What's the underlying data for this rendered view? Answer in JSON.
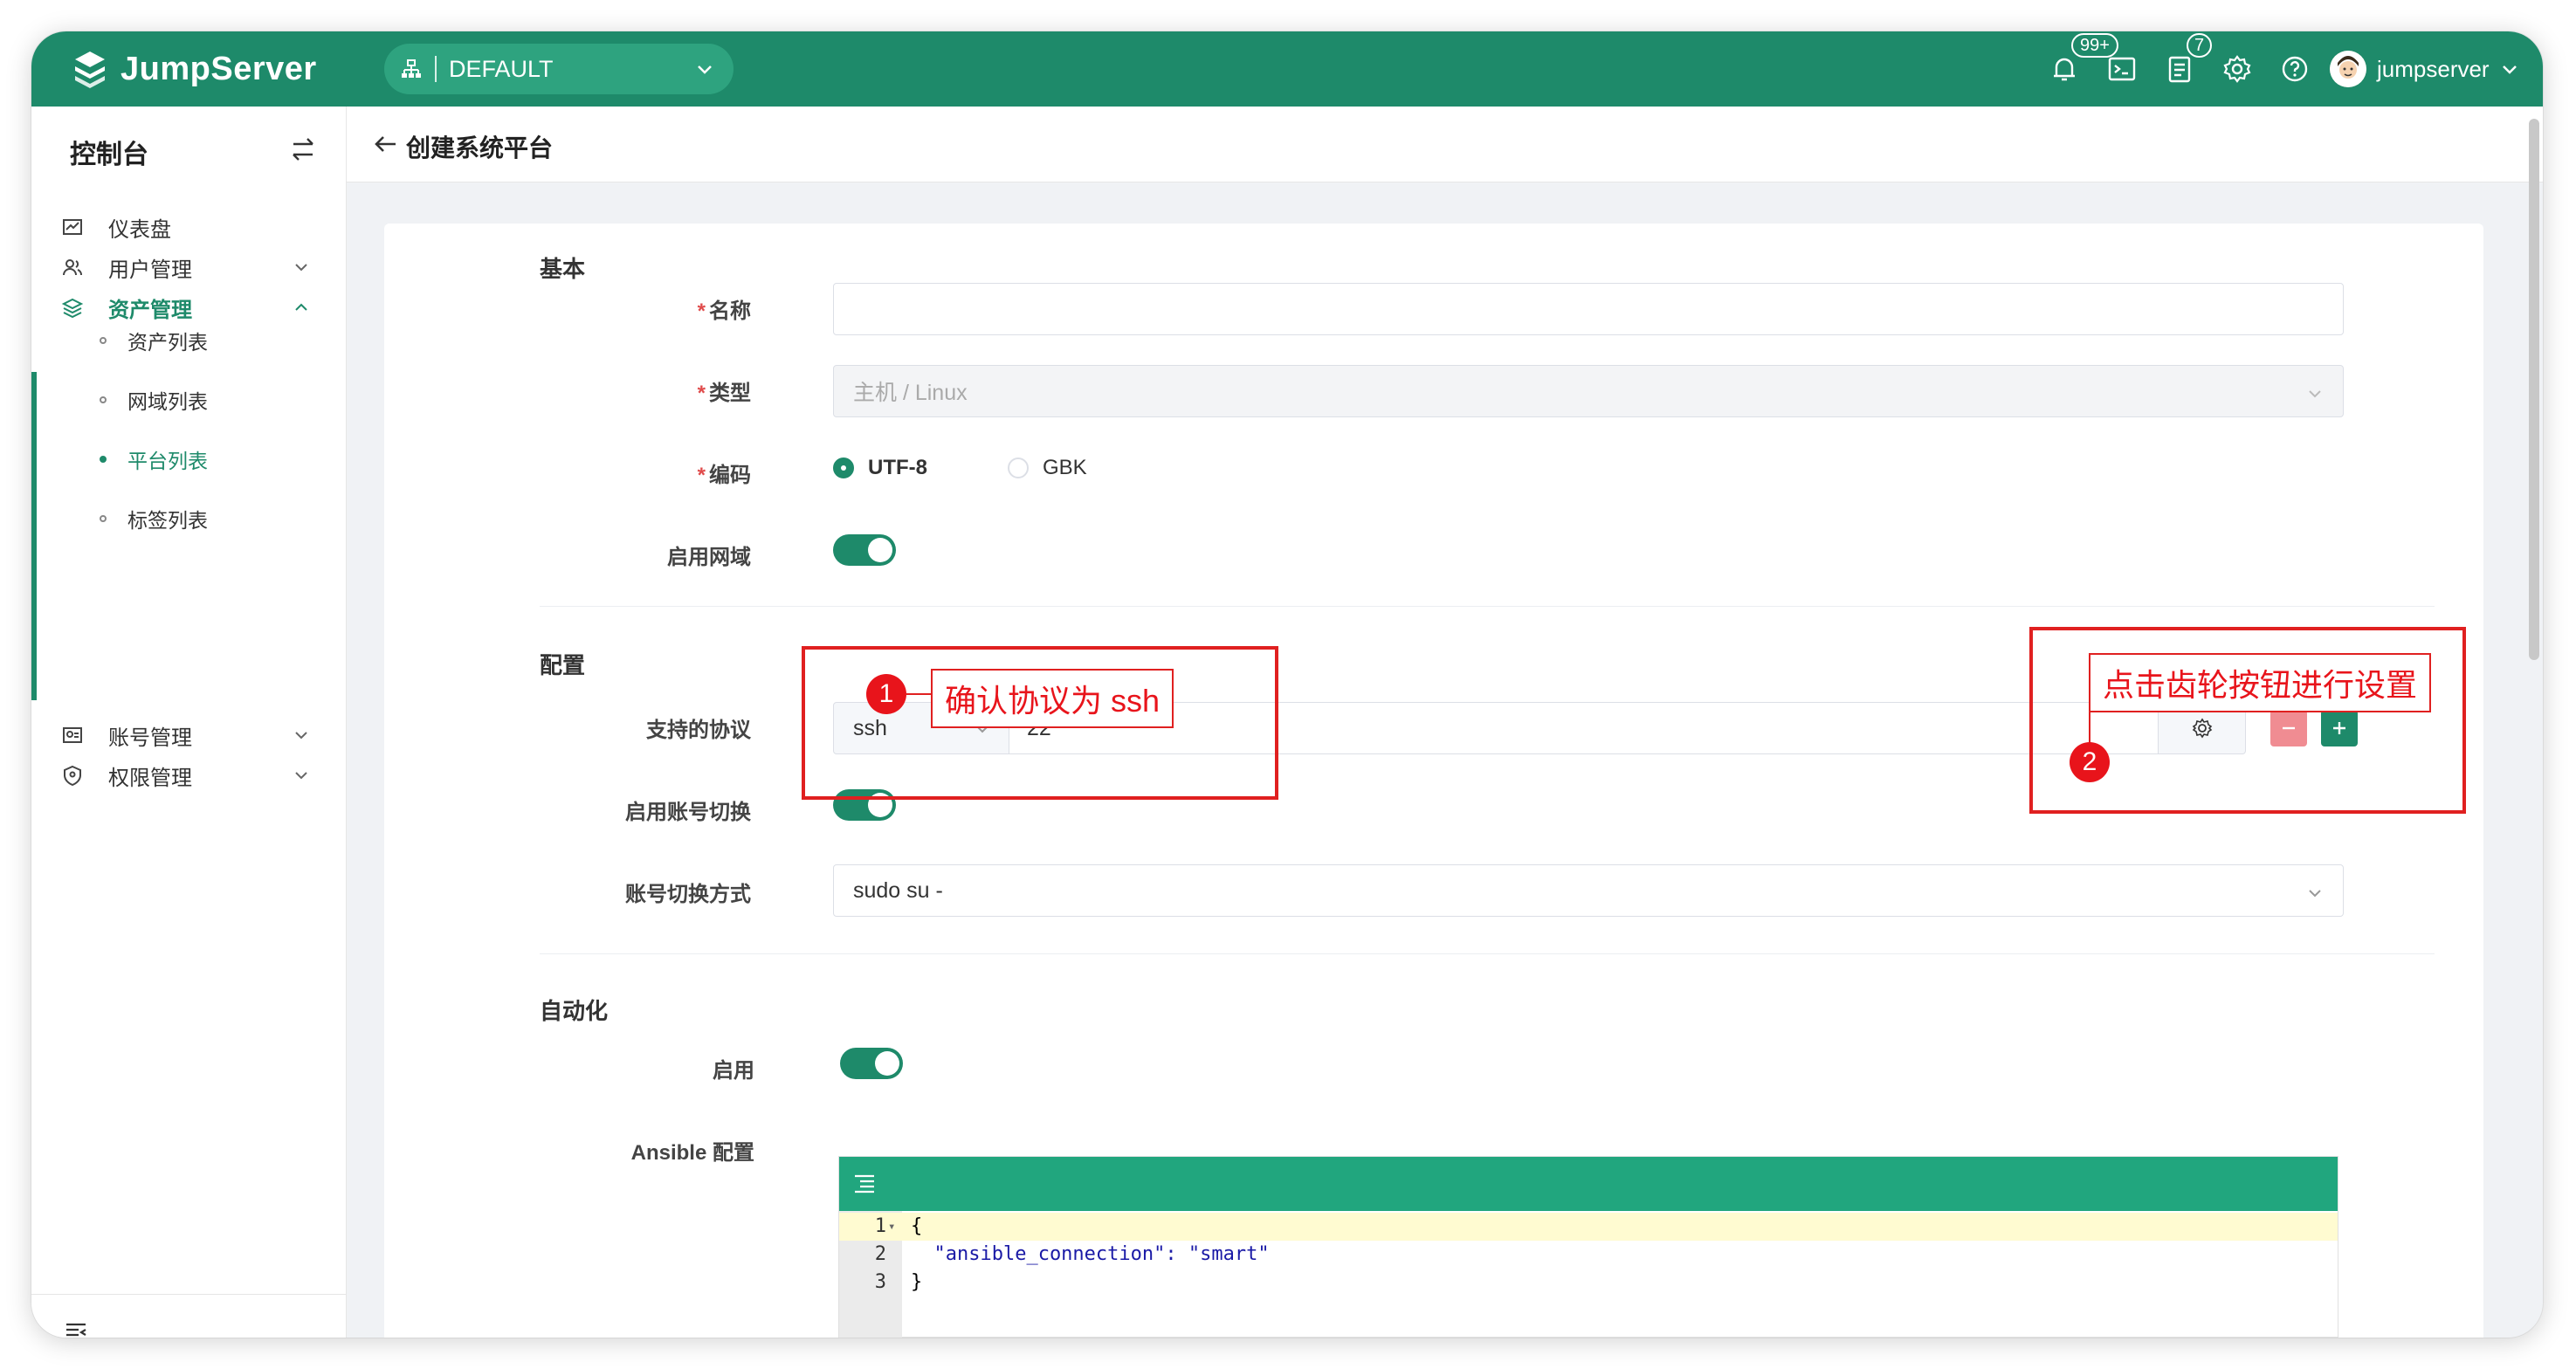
{
  "topbar": {
    "app_name": "JumpServer",
    "org": "DEFAULT",
    "notifications_badge": "99+",
    "tasks_badge": "7",
    "username": "jumpserver"
  },
  "sidebar": {
    "title": "控制台",
    "items": [
      {
        "label": "仪表盘"
      },
      {
        "label": "用户管理"
      },
      {
        "label": "资产管理"
      },
      {
        "label": "账号管理"
      },
      {
        "label": "权限管理"
      }
    ],
    "sub_items": [
      {
        "label": "资产列表"
      },
      {
        "label": "网域列表"
      },
      {
        "label": "平台列表"
      },
      {
        "label": "标签列表"
      }
    ]
  },
  "page": {
    "title": "创建系统平台"
  },
  "form": {
    "basic": {
      "section": "基本",
      "name_label": "名称",
      "name_value": "",
      "type_label": "类型",
      "type_value": "主机 / Linux",
      "charset_label": "编码",
      "charset_options": [
        "UTF-8",
        "GBK"
      ],
      "charset_selected": "UTF-8",
      "domain_label": "启用网域",
      "domain_enabled": true
    },
    "config": {
      "section": "配置",
      "protocols_label": "支持的协议",
      "protocol_name": "ssh",
      "protocol_port": "22",
      "su_label": "启用账号切换",
      "su_enabled": true,
      "su_method_label": "账号切换方式",
      "su_method_value": "sudo su -"
    },
    "automation": {
      "section": "自动化",
      "enable_label": "启用",
      "enabled": true,
      "ansible_label": "Ansible 配置",
      "code_lines": [
        {
          "num": "1",
          "text": "{"
        },
        {
          "num": "2",
          "text": "  \"ansible_connection\": \"smart\""
        },
        {
          "num": "3",
          "text": "}"
        }
      ]
    }
  },
  "annotations": [
    {
      "num": "1",
      "text": "确认协议为 ssh"
    },
    {
      "num": "2",
      "text": "点击齿轮按钮进行设置"
    }
  ],
  "colors": {
    "brand": "#1e8a6a",
    "annotation": "#e02020",
    "danger": "#f08c92"
  }
}
